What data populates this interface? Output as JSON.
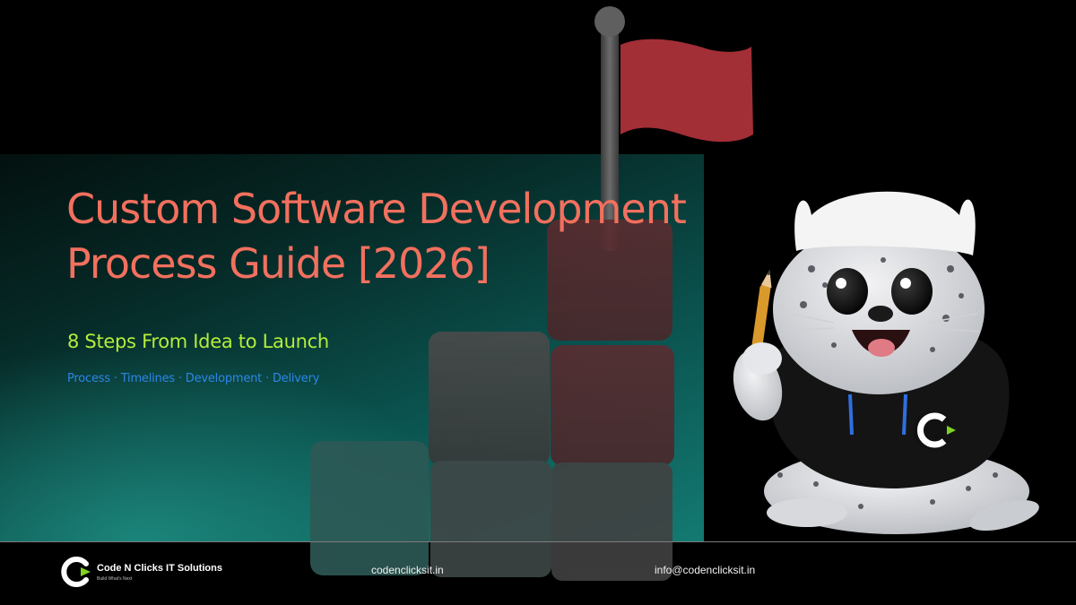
{
  "hero": {
    "title_line1": "Custom Software Development",
    "title_line2": "Process Guide [2026]",
    "subtitle": "8 Steps From Idea to Launch",
    "tagline": "Process · Timelines · Development · Delivery"
  },
  "footer": {
    "brand_name": "Code N Clicks IT Solutions",
    "brand_tagline": "Build What's Next",
    "website": "codenclicksit.in",
    "email": "info@codenclicksit.in"
  },
  "mascot": {
    "hoodie_logo_letter": "C"
  },
  "colors": {
    "title": "#f2705e",
    "subtitle": "#b4ee3a",
    "tagline": "#2b86e8",
    "background": "#000000",
    "panel_teal": "#0b5450",
    "flag": "#b8343e"
  },
  "icons": [
    "flag-icon",
    "brand-logo-icon",
    "pencil-icon"
  ]
}
